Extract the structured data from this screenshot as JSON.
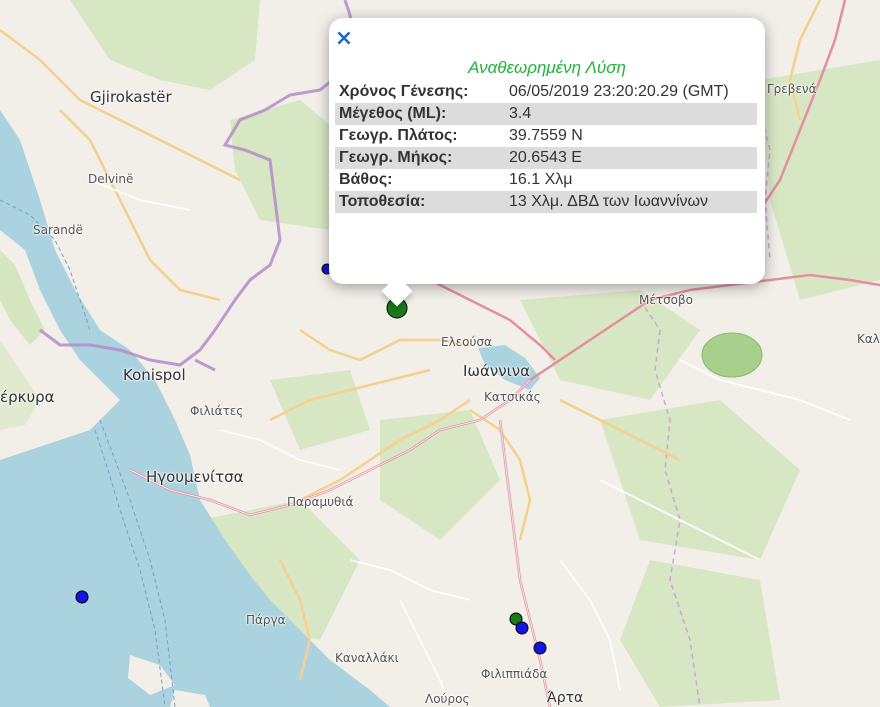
{
  "popup": {
    "close_symbol": "×",
    "title": "Αναθεωρημένη Λύση",
    "rows": [
      {
        "label": "Χρόνος Γένεσης:",
        "value": "06/05/2019 23:20:20.29 (GMT)"
      },
      {
        "label": "Μέγεθος (ML):",
        "value": "3.4"
      },
      {
        "label": "Γεωγρ. Πλάτος:",
        "value": "39.7559 N"
      },
      {
        "label": "Γεωγρ. Μήκος:",
        "value": "20.6543 E"
      },
      {
        "label": "Βάθος:",
        "value": "16.1 Χλμ"
      },
      {
        "label": "Τοποθεσία:",
        "value": "13 Χλμ. ΔΒΔ των Ιωαννίνων"
      }
    ]
  },
  "map": {
    "labels": {
      "gjirokaster": "Gjirokastër",
      "delvine": "Delvinë",
      "sarande": "Sarandë",
      "konispol": "Konispol",
      "kerkyra": "έρκυρα",
      "filiates": "Φιλιάτες",
      "igoumenitsa": "Ηγουμενίτσα",
      "paramythia": "Παραμυθιά",
      "parga": "Πάργα",
      "kanallaki": "Καναλλάκι",
      "louros": "Λούρος",
      "filippiada": "Φιλιππιάδα",
      "arta": "Άρτα",
      "eleousa": "Ελεούσα",
      "ioannina": "Ιωάννινα",
      "katsikas": "Κατσικάς",
      "metsovo": "Μέτσοβο",
      "grevena": "Γρεβενά",
      "kal": "Καλ"
    },
    "colors": {
      "sea": "#aad3df",
      "land": "#f2efe9",
      "forest": "#cfe3b8",
      "border": "#b58bc9",
      "primary_road": "#e892a2",
      "secondary_road": "#f6d08c",
      "epicenter": "#1a7a1a",
      "quake_blue": "#1414e0",
      "quake_green": "#1a7a1a"
    }
  }
}
